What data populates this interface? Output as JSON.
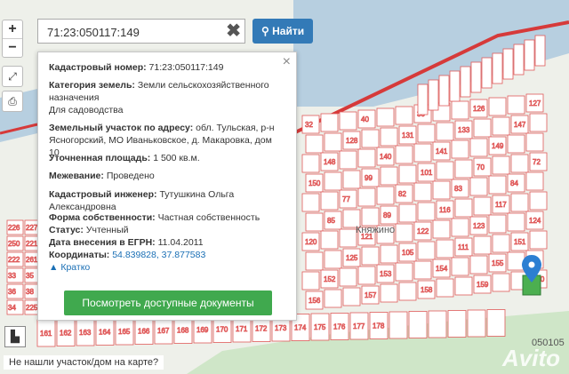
{
  "search": {
    "value": "71:23:050117:149",
    "clear_glyph": "✖",
    "button_label": "Найти"
  },
  "zoom": {
    "in": "+",
    "out": "−"
  },
  "popup": {
    "close": "×",
    "cad_num_label": "Кадастровый номер:",
    "cad_num": "71:23:050117:149",
    "category_label": "Категория земель:",
    "category": "Земли сельскохозяйственного назначения",
    "usage": "Для садоводства",
    "address_label": "Земельный участок по адресу:",
    "address": "обл. Тульская, р-н Ясногорский, МО Иваньковское, д. Макаровка, дом 10",
    "area_label": "Уточненная площадь:",
    "area": "1 500 кв.м.",
    "survey_label": "Межевание:",
    "survey": "Проведено",
    "engineer_label": "Кадастровый инженер:",
    "engineer": "Тутушкина Ольга Александровна",
    "ownership_label": "Форма собственности:",
    "ownership": "Частная собственность",
    "status_label": "Статус:",
    "status": "Учтенный",
    "date_label": "Дата внесения в ЕГРН:",
    "date": "11.04.2011",
    "coords_label": "Координаты:",
    "coords": "54.839828, 37.877583",
    "brief_link": "Кратко",
    "docs_button": "Посмотреть доступные документы"
  },
  "map": {
    "village_label": "Княжино",
    "parcel_labels": [
      "32",
      "40",
      "30",
      "126",
      "127",
      "128",
      "131",
      "133",
      "147",
      "148",
      "140",
      "141",
      "149",
      "150",
      "99",
      "101",
      "70",
      "72",
      "77",
      "82",
      "83",
      "84",
      "85",
      "89",
      "116",
      "117",
      "120",
      "121",
      "122",
      "123",
      "124",
      "125",
      "105",
      "111",
      "151",
      "152",
      "153",
      "154",
      "155",
      "156",
      "157",
      "158",
      "159",
      "160",
      "161",
      "162",
      "163",
      "164",
      "165",
      "166",
      "167",
      "168",
      "169",
      "170",
      "171",
      "172",
      "173",
      "174",
      "175",
      "176",
      "177",
      "178"
    ],
    "corner_labels": [
      "226",
      "227",
      "250",
      "221",
      "222",
      "261",
      "33",
      "35",
      "36",
      "38",
      "34",
      "225",
      "25"
    ],
    "block_label": "050105",
    "water_color": "#b7cfe0",
    "parcel_stroke": "#e05a5a",
    "selected_fill": "#4caf50",
    "marker_color": "#2c7fd2"
  },
  "legend_glyph": "▙",
  "not_found_link": "Не нашли участок/дом на карте?",
  "watermark": "Avito"
}
